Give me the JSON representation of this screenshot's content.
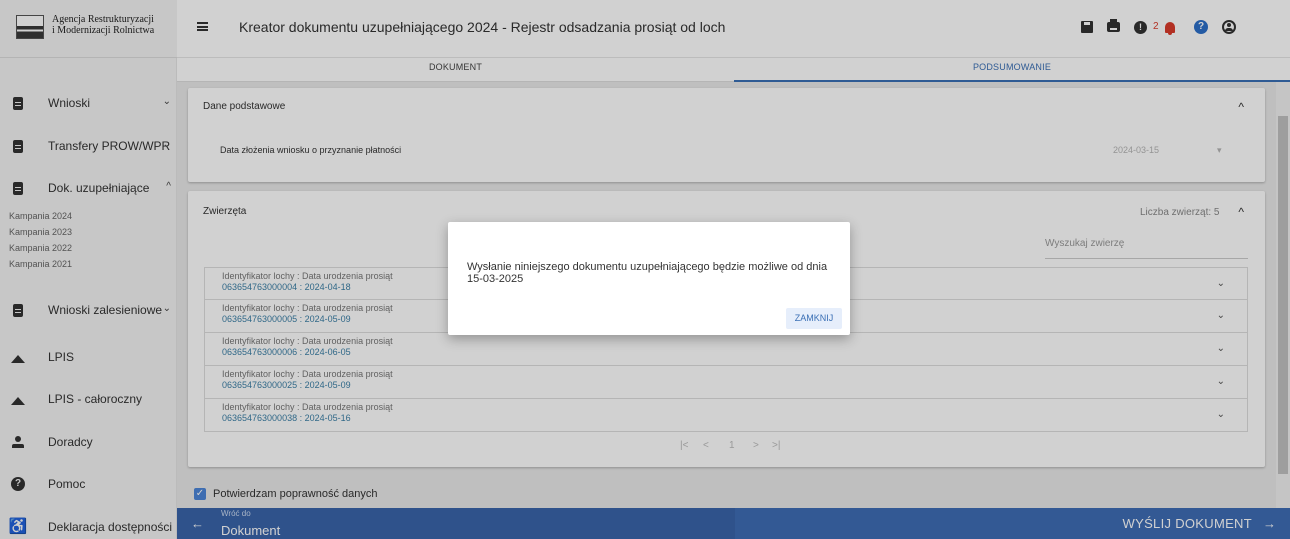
{
  "logo": {
    "line1": "Agencja Restrukturyzacji",
    "line2": "i Modernizacji Rolnictwa"
  },
  "header": {
    "title": "Kreator dokumentu uzupełniającego 2024 - Rejestr odsadzania prosiąt od loch",
    "alert_count": "2"
  },
  "sidebar": {
    "items": [
      {
        "label": "Wnioski",
        "icon": "clipboard-icon",
        "chevron": "⌄"
      },
      {
        "label": "Transfery PROW/WPR",
        "icon": "clipboard-icon",
        "chevron": "⌄"
      },
      {
        "label": "Dok. uzupełniające",
        "icon": "clipboard-icon",
        "chevron": "^"
      },
      {
        "label": "Wnioski zalesieniowe",
        "icon": "clipboard-icon",
        "chevron": "⌄"
      },
      {
        "label": "LPIS",
        "icon": "mountain-icon"
      },
      {
        "label": "LPIS - całoroczny",
        "icon": "mountain-icon"
      },
      {
        "label": "Doradcy",
        "icon": "person-icon"
      },
      {
        "label": "Pomoc",
        "icon": "help-icon"
      },
      {
        "label": "Deklaracja dostępności",
        "icon": "accessibility-icon"
      }
    ],
    "subitems": [
      "Kampania 2024",
      "Kampania 2023",
      "Kampania 2022",
      "Kampania 2021"
    ]
  },
  "tabs": [
    {
      "label": "DOKUMENT"
    },
    {
      "label": "PODSUMOWANIE",
      "active": true
    }
  ],
  "basic": {
    "heading": "Dane podstawowe",
    "date_label": "Data złożenia wniosku o przyznanie płatności",
    "date_value": "2024-03-15"
  },
  "animals": {
    "heading": "Zwierzęta",
    "count_label": "Liczba zwierząt: 5",
    "search_placeholder": "Wyszukaj zwierzę",
    "rows": [
      {
        "label": "Identyfikator lochy : Data urodzenia prosiąt",
        "value": "063654763000004 : 2024-04-18"
      },
      {
        "label": "Identyfikator lochy : Data urodzenia prosiąt",
        "value": "063654763000005 : 2024-05-09"
      },
      {
        "label": "Identyfikator lochy : Data urodzenia prosiąt",
        "value": "063654763000006 : 2024-06-05"
      },
      {
        "label": "Identyfikator lochy : Data urodzenia prosiąt",
        "value": "063654763000025 : 2024-05-09"
      },
      {
        "label": "Identyfikator lochy : Data urodzenia prosiąt",
        "value": "063654763000038  : 2024-05-16"
      }
    ],
    "pagination": {
      "first": "|<",
      "prev": "<",
      "page": "1",
      "next": ">",
      "last": ">|"
    }
  },
  "confirm_label": "Potwierdzam poprawność danych",
  "footer": {
    "back_small": "Wróć do",
    "back_big": "Dokument",
    "send": "WYŚLIJ DOKUMENT"
  },
  "dialog": {
    "message": "Wysłanie niniejszego dokumentu uzupełniającego będzie możliwe od dnia 15-03-2025",
    "close": "ZAMKNIJ"
  },
  "colors": {
    "primary": "#3d6ab0",
    "accent_red": "#d93b2b",
    "link": "#3b7fa6"
  }
}
